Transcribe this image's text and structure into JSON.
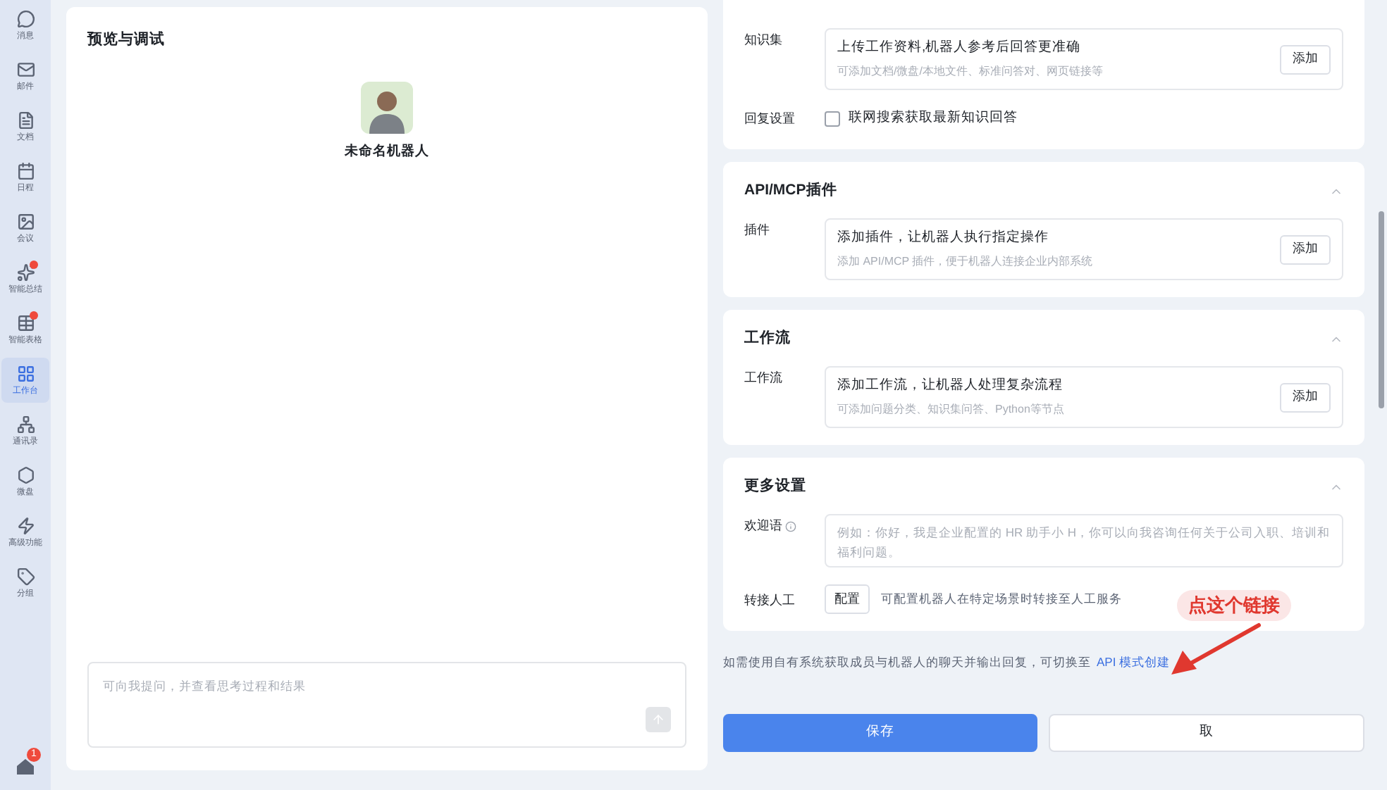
{
  "sidebar": {
    "items": [
      {
        "label": "消息",
        "selected": false,
        "dot": false
      },
      {
        "label": "邮件",
        "selected": false,
        "dot": false
      },
      {
        "label": "文档",
        "selected": false,
        "dot": false
      },
      {
        "label": "日程",
        "selected": false,
        "dot": false
      },
      {
        "label": "会议",
        "selected": false,
        "dot": false
      },
      {
        "label": "智能总结",
        "selected": false,
        "dot": true
      },
      {
        "label": "智能表格",
        "selected": false,
        "dot": true
      },
      {
        "label": "工作台",
        "selected": true,
        "dot": false
      },
      {
        "label": "通讯录",
        "selected": false,
        "dot": false
      },
      {
        "label": "微盘",
        "selected": false,
        "dot": false
      },
      {
        "label": "高级功能",
        "selected": false,
        "dot": false
      },
      {
        "label": "分组",
        "selected": false,
        "dot": false
      }
    ],
    "bottom_badge": "1"
  },
  "preview": {
    "title": "预览与调试",
    "bot_name": "未命名机器人",
    "input": {
      "placeholder": "可向我提问，并查看思考过程和结果"
    }
  },
  "sections": [
    {
      "rows": [
        {
          "kind": "add",
          "label": "知识集",
          "heading": "上传工作资料,机器人参考后回答更准确",
          "hint": "可添加文档/微盘/本地文件、标准问答对、网页链接等",
          "button": "添加"
        },
        {
          "kind": "checkbox",
          "label": "回复设置",
          "text": "联网搜索获取最新知识回答",
          "checked": false
        }
      ]
    },
    {
      "title": "API/MCP插件",
      "expanded": true,
      "rows": [
        {
          "kind": "add",
          "label": "插件",
          "heading": "添加插件，让机器人执行指定操作",
          "hint": "添加 API/MCP 插件，便于机器人连接企业内部系统",
          "button": "添加"
        }
      ]
    },
    {
      "title": "工作流",
      "expanded": true,
      "rows": [
        {
          "kind": "add",
          "label": "工作流",
          "heading": "添加工作流，让机器人处理复杂流程",
          "hint": "可添加问题分类、知识集问答、Python等节点",
          "button": "添加"
        }
      ]
    },
    {
      "title": "更多设置",
      "expanded": true,
      "rows": [
        {
          "kind": "textarea",
          "label": "欢迎语",
          "info": true,
          "placeholder": "例如：你好，我是企业配置的 HR 助手小 H，你可以向我咨询任何关于公司入职、培训和福利问题。"
        },
        {
          "kind": "config",
          "label": "转接人工",
          "button": "配置",
          "text": "可配置机器人在特定场景时转接至人工服务"
        }
      ]
    }
  ],
  "note": {
    "text": "如需使用自有系统获取成员与机器人的聊天并输出回复，可切换至",
    "link": "API 模式创建"
  },
  "annotation": "点这个链接",
  "buttons": {
    "save": "保存",
    "cancel": "取"
  }
}
